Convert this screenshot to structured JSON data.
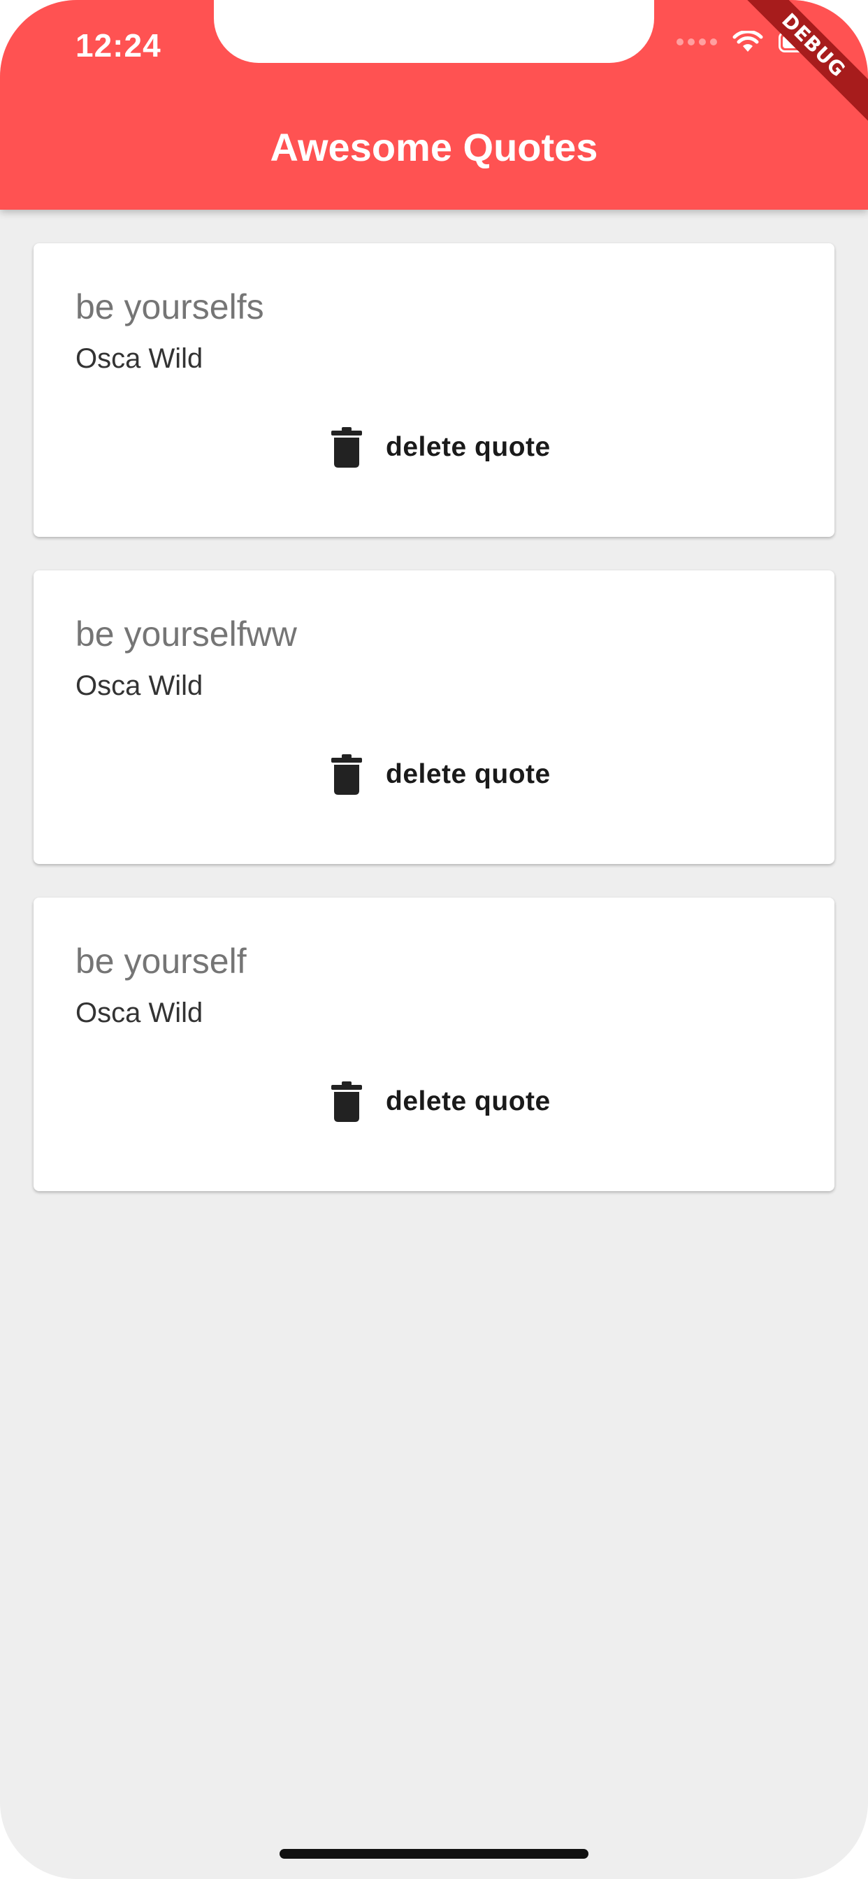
{
  "status_bar": {
    "time": "12:24"
  },
  "debug_banner": "DEBUG",
  "app_bar": {
    "title": "Awesome Quotes",
    "color": "#ff5252"
  },
  "quotes": [
    {
      "text": "be yourselfs",
      "author": "Osca Wild",
      "delete_label": "delete quote",
      "icon": "trash-icon"
    },
    {
      "text": "be yourselfww",
      "author": "Osca Wild",
      "delete_label": "delete quote",
      "icon": "trash-icon"
    },
    {
      "text": "be yourself",
      "author": "Osca Wild",
      "delete_label": "delete quote",
      "icon": "trash-icon"
    }
  ]
}
